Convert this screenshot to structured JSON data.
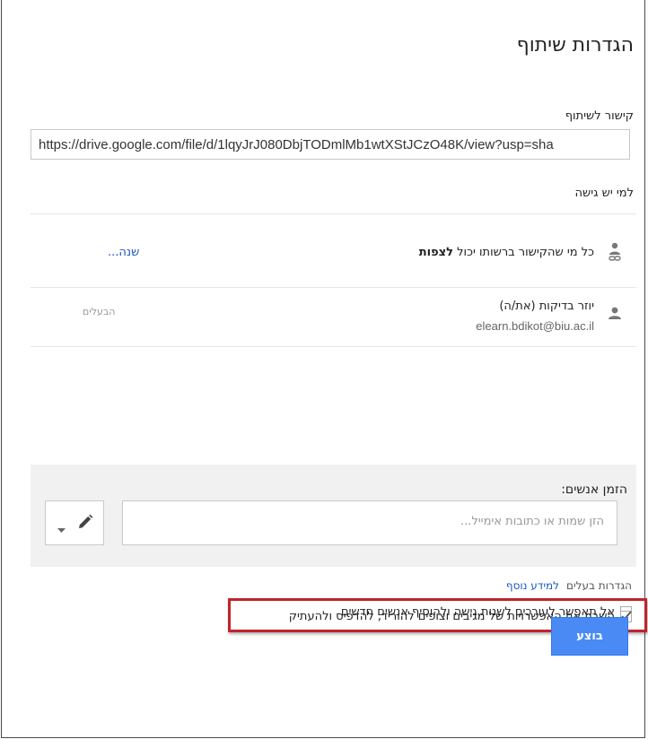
{
  "dialog": {
    "title": "הגדרות שיתוף",
    "link_section_label": "קישור לשיתוף",
    "share_link": "https://drive.google.com/file/d/1lqyJrJ080DbjTODmlMb1wtXStJCzO48K/view?usp=sha",
    "access_section_label": "למי יש גישה",
    "access_rows": [
      {
        "icon": "link-person-icon",
        "text_prefix": "כל מי שהקישור ברשותו יכול ",
        "text_bold": "לצפות",
        "action": "שנה..."
      },
      {
        "icon": "person-icon",
        "name": "יוזר בדיקות (את/ה)",
        "email": "elearn.bdikot@biu.ac.il",
        "role": "הבעלים"
      }
    ],
    "invite": {
      "label": "הזמן אנשים:",
      "placeholder": "הזן שמות או כתובות אימייל...",
      "permission_icon": "pencil-icon"
    },
    "owner_settings": {
      "label": "הגדרות בעלים",
      "learn_more": "למידע נוסף"
    },
    "options": [
      {
        "label": "אל תאפשר לעורכים לשנות גישה ולהוסיף אנשים חדשים",
        "checked": false
      },
      {
        "label": "השבת את האפשרויות של מגיבים וצופים להוריד, להדפיס ולהעתיק",
        "checked": true
      }
    ],
    "done_button": "בוצע",
    "colors": {
      "accent": "#4a8af4",
      "link": "#1a55c6",
      "highlight": "#c0242c"
    }
  }
}
